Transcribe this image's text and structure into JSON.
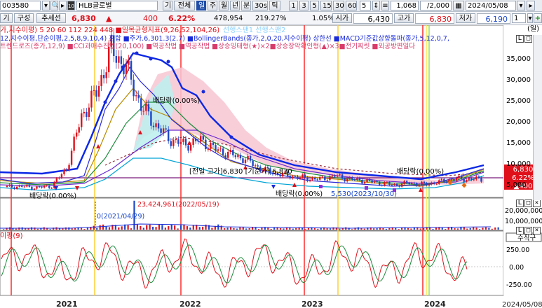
{
  "toolbar": {
    "code": "003580",
    "name": "HLB글로벌",
    "period_label": "기",
    "range_label": "전체",
    "periods": [
      "일",
      "주",
      "월",
      "년",
      "분",
      "30s",
      "틱"
    ],
    "active_period": "일",
    "nums": [
      "1",
      "3",
      "5",
      "15",
      "30",
      "60",
      "5"
    ],
    "count1": "1,068",
    "count2": "/2,000",
    "date": "2024/05/08"
  },
  "quote": {
    "tab1": "기",
    "compose": "구성",
    "add": "추세선",
    "price": "6,830",
    "arrow": "▲",
    "change": "400",
    "pct": "6.22%",
    "volume": "478,954",
    "vol_ratio": "219.27%",
    "turnover": "1.05%",
    "open_label": "시가",
    "open": "6,430",
    "high_label": "고가",
    "high": "6,830",
    "low_label": "저가",
    "low": "6,190",
    "spin": "1"
  },
  "legend": {
    "line1": "가,지수이평) 5 20 60 112 224 448 ■일목균형지표(9,26,52,104,26)",
    "line1b": "선행스팬1 선행스팬2",
    "line2": "12,지수이평,단순이평,2,5,8,9,10,4) 혼합 ■주가.6,301.3(2.7) ■BollingerBands(종가,2,0,20,지수이평) 상한선 ■MACD기준값상향돌파(종가,5,12,0,7,",
    "line3": "트렌드로즈(종가,12,9) ■CCI과매수진입(20,100) ■역공작법 ■역공작법 ■상승잉태형(★)×2■상승장악확인형(▲)×3■전기찌릿 ■외공방편일다"
  },
  "annotations": {
    "div1": "배당락(0.00%)",
    "div2": "배당락(0.00%)",
    "div3": "배당락(0.00%)",
    "div4": "배당락(0.00%)",
    "prev_high": "[전일 고가]6,830 [기준가] 6,830",
    "low_mark": "5,530(2023/10/30)",
    "vol_peak": "23,424,961(2022/05/19)",
    "vol_low": "0(2021/04/29)"
  },
  "axes": {
    "unit": "(일)",
    "price_ticks": [
      "35,000",
      "30,000",
      "25,000",
      "20,000",
      "15,000",
      "10,000",
      "5,000"
    ],
    "price_box": [
      "6,830",
      "6.22%",
      "▲400"
    ],
    "vol_ticks": [
      "20,000,000",
      "10,000,000"
    ],
    "osc_label": "수직구",
    "osc_title": "이평(9)",
    "osc_ticks": [
      "250.00",
      "0.00",
      "-250.00"
    ],
    "years": [
      "2021",
      "2022",
      "2023",
      "2024"
    ],
    "last_date": "2024/05/08"
  },
  "colors": {
    "up": "#e0101a",
    "down": "#1a47c9",
    "bollinger_upper": "#0a27e6",
    "cloud": "#f3b6c8",
    "cloud2": "#b3ece9"
  },
  "chart_data": {
    "type": "candlestick",
    "x": [
      "2021-01",
      "2021-03",
      "2021-05",
      "2021-07",
      "2021-08",
      "2021-09",
      "2021-10",
      "2021-11",
      "2021-12",
      "2022-01",
      "2022-02",
      "2022-03",
      "2022-04",
      "2022-05",
      "2022-06",
      "2022-07",
      "2022-08",
      "2022-09",
      "2022-10",
      "2022-11",
      "2022-12",
      "2023-01",
      "2023-03",
      "2023-05",
      "2023-07",
      "2023-09",
      "2023-10",
      "2023-12",
      "2024-01",
      "2024-02",
      "2024-03",
      "2024-04",
      "2024-05"
    ],
    "close": [
      5200,
      5300,
      5000,
      5400,
      9000,
      20000,
      25000,
      34000,
      30000,
      22000,
      18000,
      15000,
      14000,
      15000,
      13000,
      12000,
      11000,
      9000,
      8000,
      7500,
      7000,
      6800,
      7500,
      6800,
      6500,
      6000,
      5600,
      6000,
      5700,
      6200,
      6900,
      6800,
      6830
    ],
    "volume_peak": {
      "date": "2022/05/19",
      "value": 23424961
    },
    "price_ylim": [
      3000,
      39000
    ],
    "volume_ylim": [
      0,
      25000000
    ],
    "osc_ylim": [
      -320,
      320
    ]
  }
}
